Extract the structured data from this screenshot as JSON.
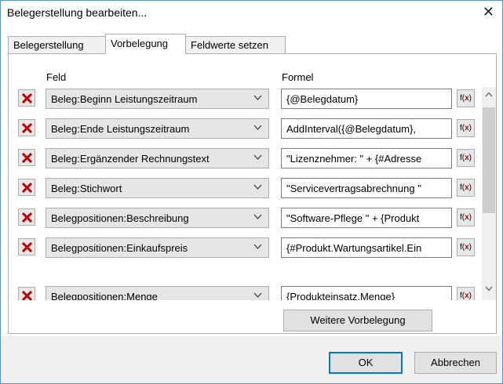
{
  "window": {
    "title": "Belegerstellung bearbeiten...",
    "close_symbol": "✕"
  },
  "tabs": [
    {
      "label": "Belegerstellung",
      "active": false
    },
    {
      "label": "Vorbelegung",
      "active": true
    },
    {
      "label": "Feldwerte setzen",
      "active": false
    }
  ],
  "columns": {
    "field": "Feld",
    "formula": "Formel"
  },
  "rows": [
    {
      "field": "Beleg:Beginn Leistungszeitraum",
      "formula": "{@Belegdatum}"
    },
    {
      "field": "Beleg:Ende Leistungszeitraum",
      "formula": "AddInterval({@Belegdatum},"
    },
    {
      "field": "Beleg:Ergänzender Rechnungstext",
      "formula": "\"Lizenznehmer: \" + {#Adresse"
    },
    {
      "field": "Beleg:Stichwort",
      "formula": "\"Servicevertragsabrechnung \""
    },
    {
      "field": "Belegpositionen:Beschreibung",
      "formula": "\"Software-Pflege \" + {Produkt"
    },
    {
      "field": "Belegpositionen:Einkaufspreis",
      "formula": "{#Produkt.Wartungsartikel.Ein"
    },
    {
      "field": "Belegpositionen:Menge",
      "formula": "{Produkteinsatz.Menge}"
    }
  ],
  "fx_label": {
    "f": "f(",
    "x": "x",
    "close": ")"
  },
  "buttons": {
    "more": "Weitere Vorbelegung",
    "ok": "OK",
    "cancel": "Abbrechen"
  },
  "colors": {
    "delete_x": "#c00000",
    "accent": "#0078d7"
  }
}
